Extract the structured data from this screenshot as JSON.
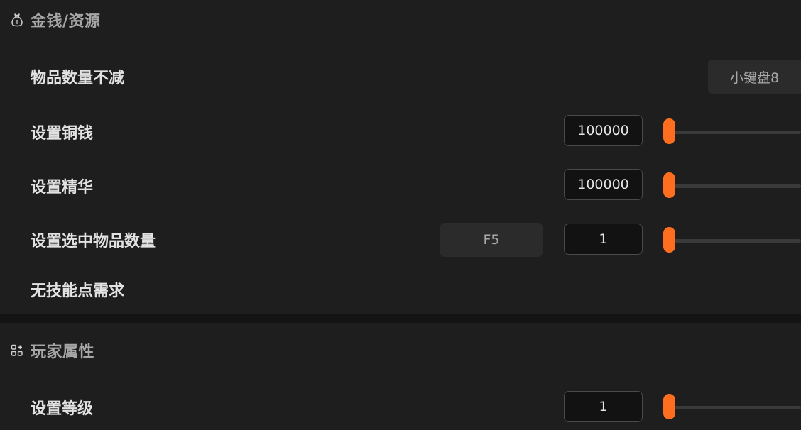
{
  "sections": {
    "money": {
      "title": "金钱/资源",
      "icon": "money-bag-icon"
    },
    "player": {
      "title": "玩家属性",
      "icon": "attributes-grid-icon"
    }
  },
  "rows": {
    "item_qty_no_decrease": {
      "label": "物品数量不减",
      "hotkey": "小键盘8"
    },
    "set_copper": {
      "label": "设置铜钱",
      "value": "100000",
      "slider_level": 0.0
    },
    "set_essence": {
      "label": "设置精华",
      "value": "100000",
      "slider_level": 0.0
    },
    "set_selected_item_qty": {
      "label": "设置选中物品数量",
      "hotkey": "F5",
      "value": "1",
      "slider_level": 0.0
    },
    "no_skill_point_req": {
      "label": "无技能点需求"
    },
    "set_level": {
      "label": "设置等级",
      "value": "1",
      "slider_level": 0.0
    }
  },
  "colors": {
    "accent": "#ff6e1f",
    "background": "#1e1e1e",
    "input_background": "#121212",
    "hotkey_background": "#2b2b2b"
  }
}
